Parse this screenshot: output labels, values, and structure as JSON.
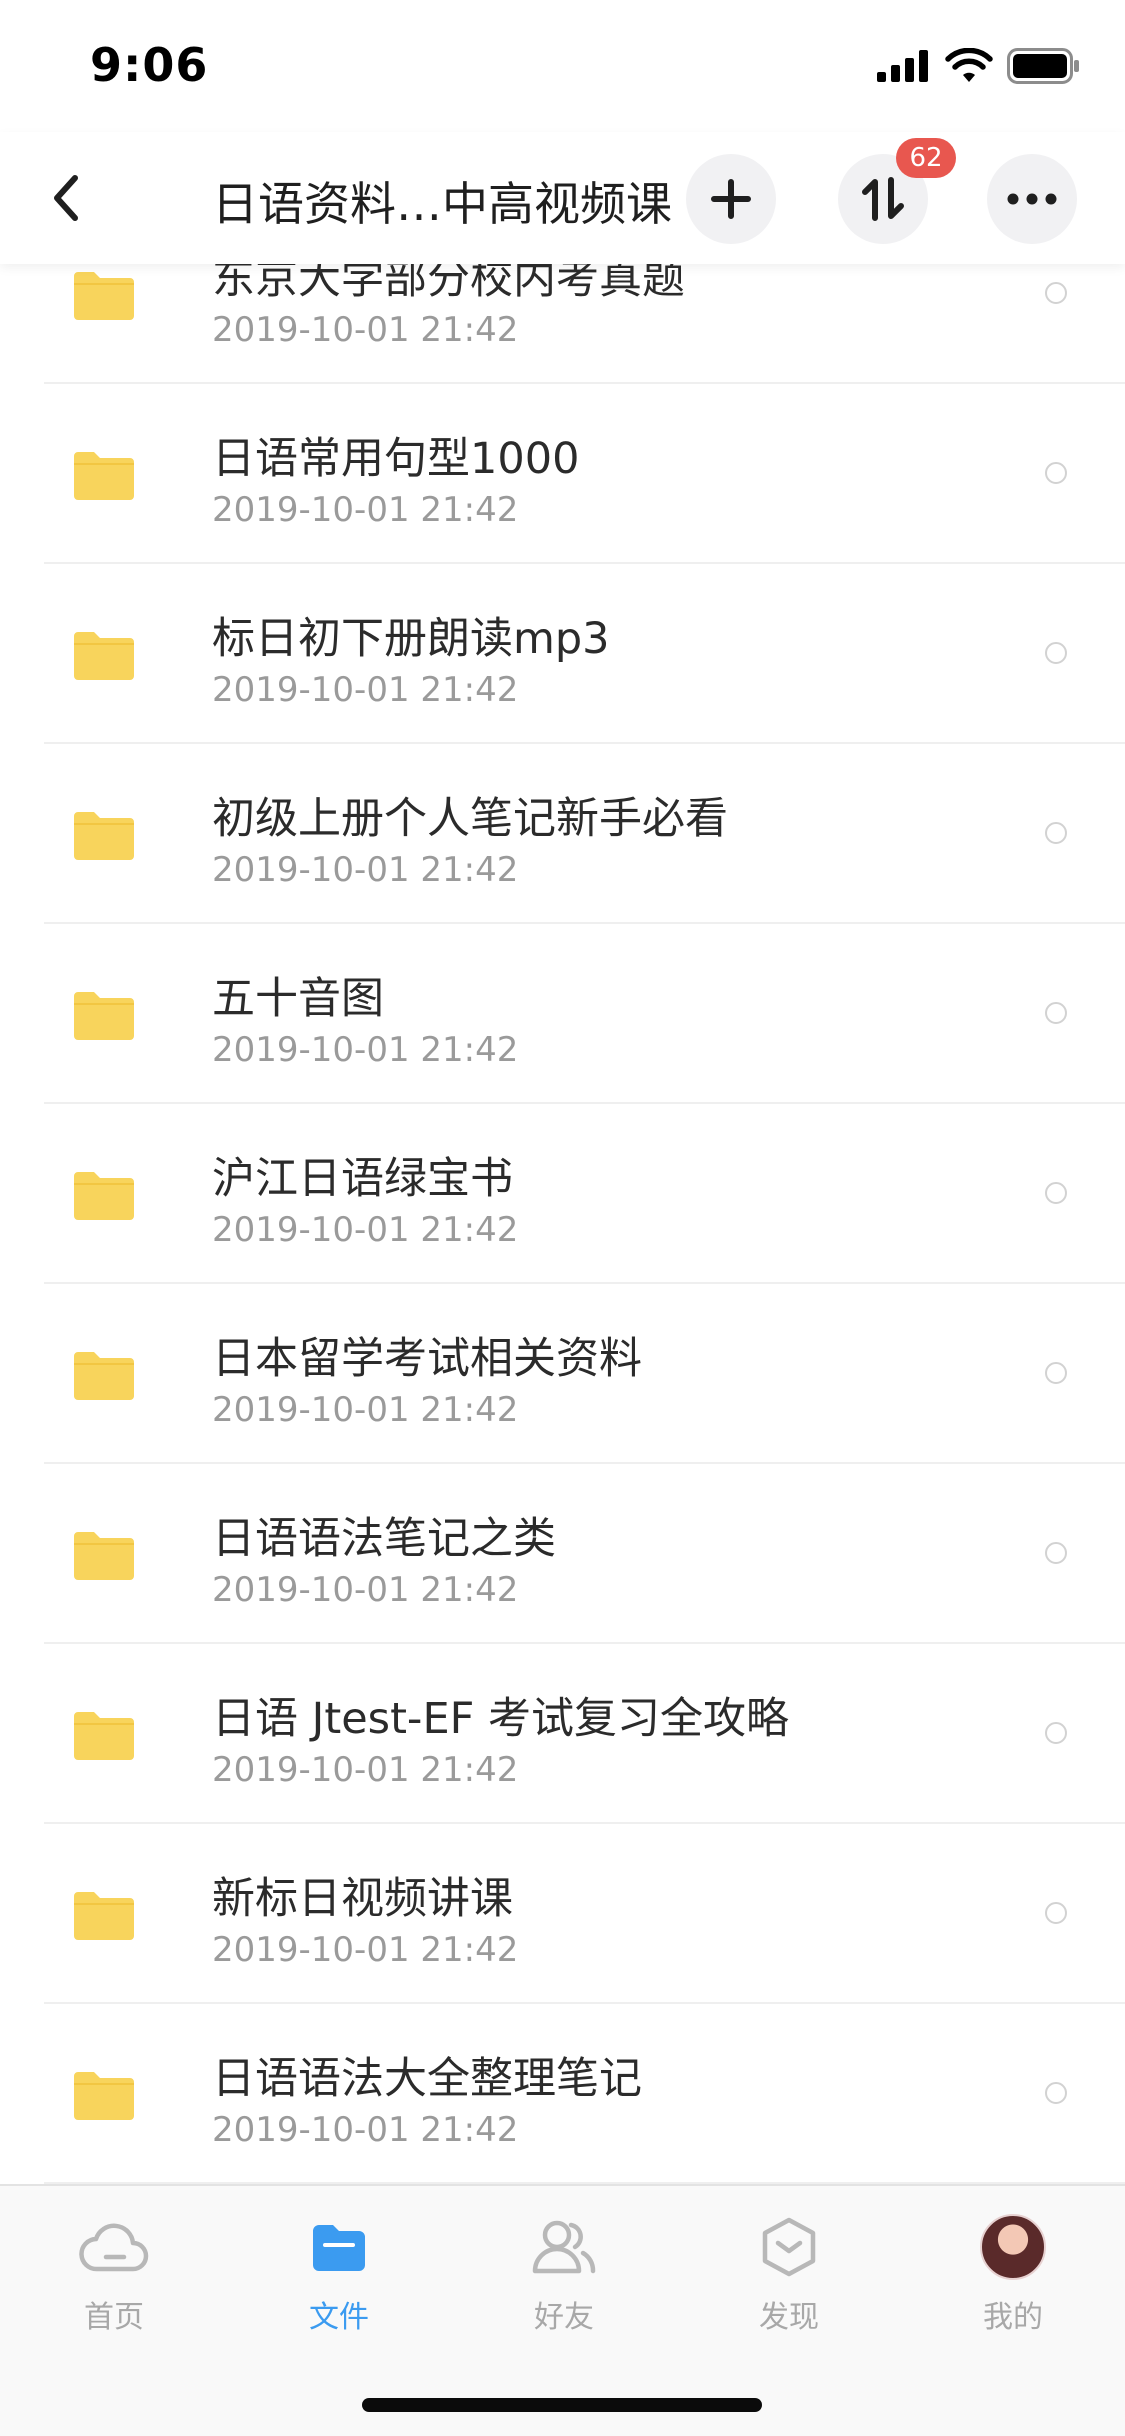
{
  "status_bar": {
    "time": "9:06"
  },
  "header": {
    "title": "日语资料…中高视频课",
    "transfer_badge": "62"
  },
  "files": [
    {
      "name": "东京大学部分校内考真题",
      "date": "2019-10-01 21:42"
    },
    {
      "name": "日语常用句型1000",
      "date": "2019-10-01 21:42"
    },
    {
      "name": "标日初下册朗读mp3",
      "date": "2019-10-01 21:42"
    },
    {
      "name": "初级上册个人笔记新手必看",
      "date": "2019-10-01 21:42"
    },
    {
      "name": "五十音图",
      "date": "2019-10-01 21:42"
    },
    {
      "name": "沪江日语绿宝书",
      "date": "2019-10-01 21:42"
    },
    {
      "name": "日本留学考试相关资料",
      "date": "2019-10-01 21:42"
    },
    {
      "name": "日语语法笔记之类",
      "date": "2019-10-01 21:42"
    },
    {
      "name": "日语 Jtest-EF 考试复习全攻略",
      "date": "2019-10-01 21:42"
    },
    {
      "name": "新标日视频讲课",
      "date": "2019-10-01 21:42"
    },
    {
      "name": "日语语法大全整理笔记",
      "date": "2019-10-01 21:42"
    }
  ],
  "tabs": [
    {
      "label": "首页",
      "icon": "cloud-icon",
      "active": false
    },
    {
      "label": "文件",
      "icon": "folder-icon",
      "active": true
    },
    {
      "label": "好友",
      "icon": "friends-icon",
      "active": false
    },
    {
      "label": "发现",
      "icon": "discover-icon",
      "active": false
    },
    {
      "label": "我的",
      "icon": "avatar",
      "active": false
    }
  ],
  "colors": {
    "accent": "#3b9bf0",
    "folder": "#f8d45c",
    "badge": "#e8574f"
  }
}
